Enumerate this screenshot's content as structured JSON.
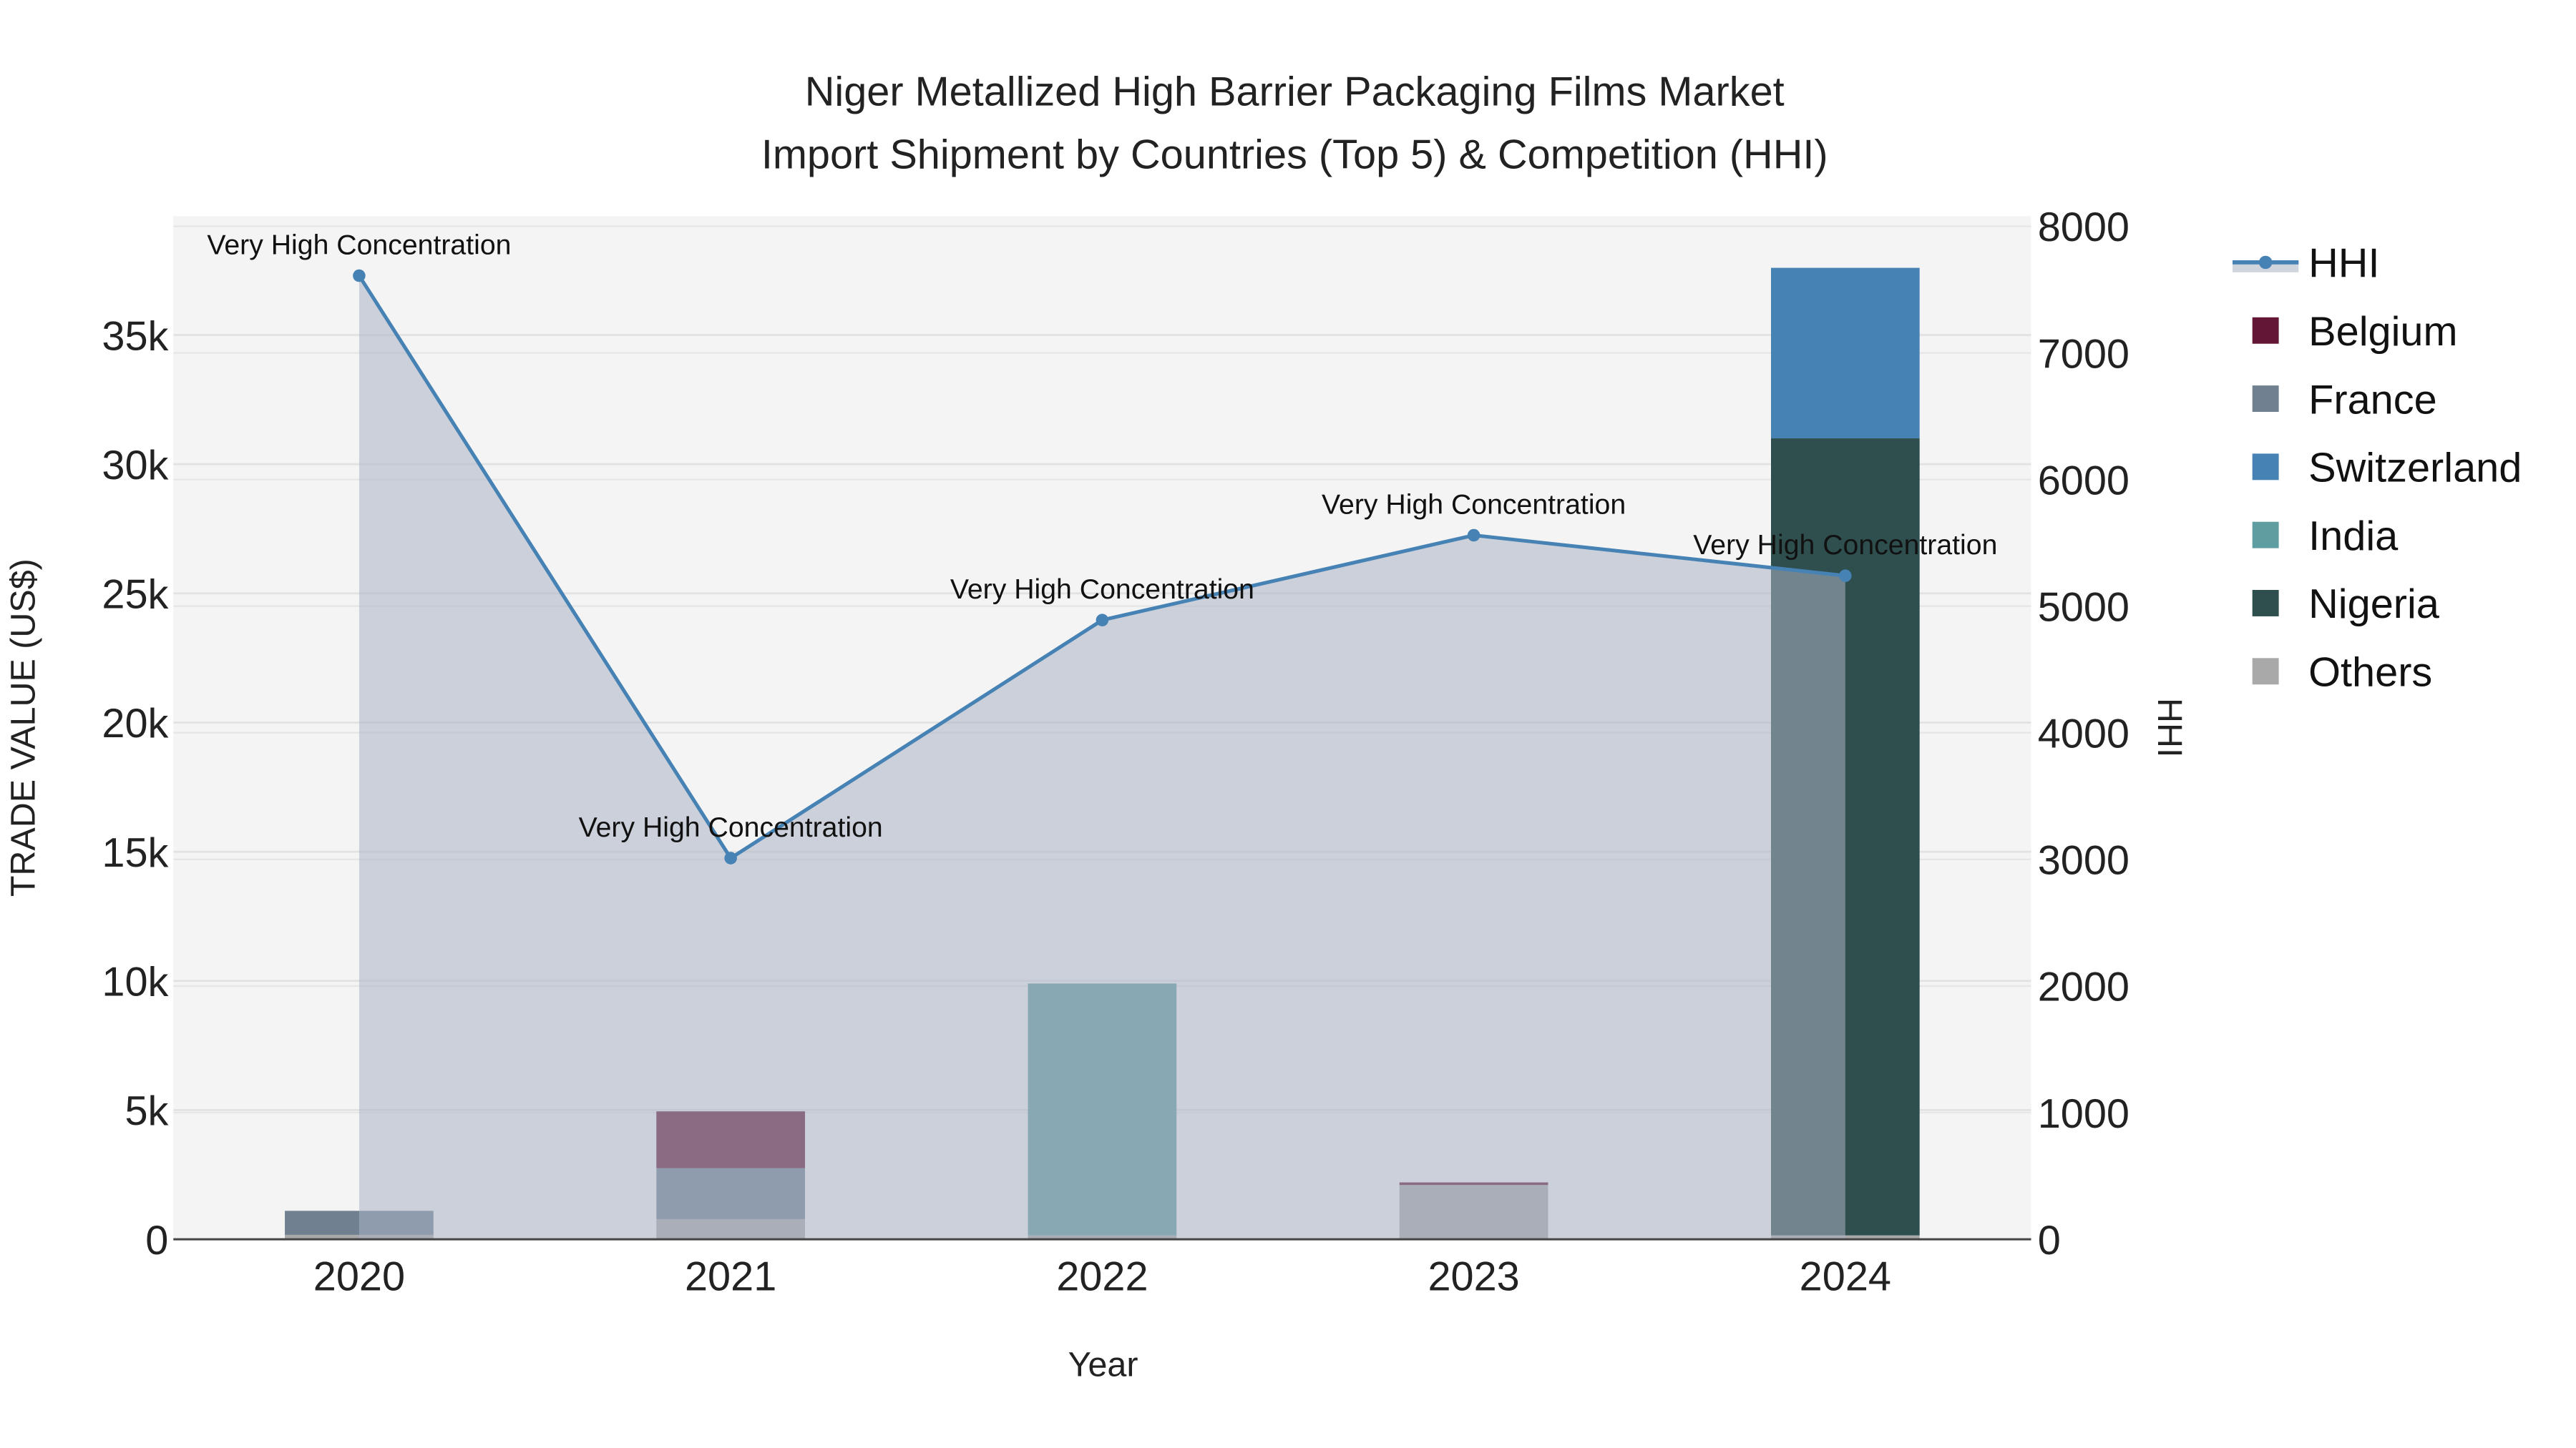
{
  "chart_data": {
    "type": "bar",
    "title_line1": "Niger Metallized High Barrier Packaging Films Market",
    "title_line2": "Import Shipment by Countries (Top 5) & Competition (HHI)",
    "xlabel": "Year",
    "ylabel": "TRADE VALUE (US$)",
    "y2label": "HHI",
    "categories": [
      "2020",
      "2021",
      "2022",
      "2023",
      "2024"
    ],
    "ylim": [
      0,
      39600
    ],
    "y2lim": [
      0,
      8080
    ],
    "yticks": [
      0,
      5000,
      10000,
      15000,
      20000,
      25000,
      30000,
      35000
    ],
    "ytick_labels": [
      "0",
      "5k",
      "10k",
      "15k",
      "20k",
      "25k",
      "30k",
      "35k"
    ],
    "y2ticks": [
      0,
      1000,
      2000,
      3000,
      4000,
      5000,
      6000,
      7000,
      8000
    ],
    "y2tick_labels": [
      "0",
      "1000",
      "2000",
      "3000",
      "4000",
      "5000",
      "6000",
      "7000",
      "8000"
    ],
    "grid": true,
    "barmode": "stack",
    "legend_position": "right",
    "series": [
      {
        "name": "Others",
        "color": "#a9a9a9",
        "values": [
          170,
          780,
          150,
          2100,
          150
        ]
      },
      {
        "name": "Nigeria",
        "color": "#2f4f4f",
        "values": [
          0,
          0,
          0,
          0,
          30850
        ]
      },
      {
        "name": "India",
        "color": "#5f9ea0",
        "values": [
          0,
          0,
          9750,
          0,
          0
        ]
      },
      {
        "name": "Switzerland",
        "color": "#4682b4",
        "values": [
          0,
          0,
          0,
          0,
          6600
        ]
      },
      {
        "name": "France",
        "color": "#708090",
        "values": [
          930,
          1970,
          0,
          0,
          0
        ]
      },
      {
        "name": "Belgium",
        "color": "#641636",
        "values": [
          0,
          2200,
          0,
          100,
          0
        ]
      }
    ],
    "legend_order": [
      "HHI",
      "Belgium",
      "France",
      "Switzerland",
      "India",
      "Nigeria",
      "Others"
    ],
    "hhi": {
      "name": "HHI",
      "color": "#4682b4",
      "values": [
        7610,
        3010,
        4890,
        5560,
        5240
      ],
      "annotations": [
        "Very High Concentration",
        "Very High Concentration",
        "Very High Concentration",
        "Very High Concentration",
        "Very High Concentration"
      ]
    }
  }
}
